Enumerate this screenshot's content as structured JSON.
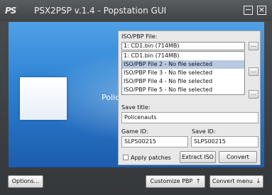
{
  "window": {
    "logo_text": "PS",
    "title": "PSX2PSP v.1.4 - Popstation GUI",
    "minimize_symbol": "−",
    "close_symbol": "×"
  },
  "stage": {
    "game_title_overlay": "Policenauts"
  },
  "iso_panel": {
    "label": "ISO/PBP File:",
    "selected_value": "1: CD1.bin (714MB)",
    "browse_label": "...",
    "files": [
      "1: CD1.bin (714MB)",
      "ISO/PBP File 2 - No file selected",
      "ISO/PBP File 3 - No file selected",
      "ISO/PBP File 4 - No file selected",
      "ISO/PBP File 5 - No file selected"
    ]
  },
  "save_title": {
    "label": "Save title:",
    "value": "Policenauts"
  },
  "game_id": {
    "label": "Game ID:",
    "value": "SLPS00215"
  },
  "save_id": {
    "label": "Save ID:",
    "value": "SLPS00215"
  },
  "options": {
    "apply_patches_label": "Apply patches",
    "apply_patches_checked": false,
    "extract_iso_label": "Extract ISO",
    "convert_label": "Convert"
  },
  "bottom_bar": {
    "options_label": "Options...",
    "customize_label": "Customize PBP",
    "customize_arrow": "↑",
    "convert_menu_label": "Convert menu",
    "convert_menu_arrow": "↓"
  },
  "colors": {
    "stage_top": "#4fa0e6",
    "stage_bottom": "#1c5cae",
    "selection": "#b9c9e0"
  }
}
